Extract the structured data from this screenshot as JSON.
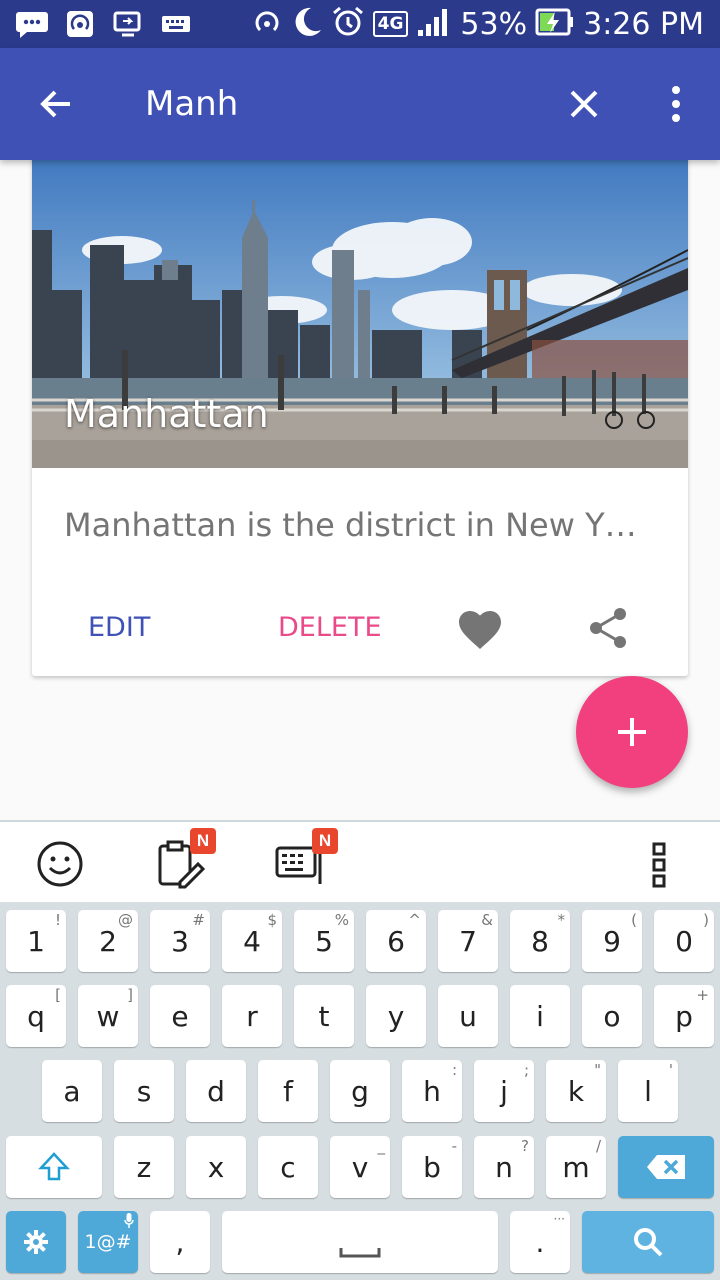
{
  "status_bar": {
    "network": "4G",
    "battery": "53%",
    "time": "3:26 PM"
  },
  "app_bar": {
    "search_value": "Manh"
  },
  "card": {
    "title": "Manhattan",
    "description": "Manhattan is the district in New Y…",
    "edit_label": "EDIT",
    "delete_label": "DELETE"
  },
  "colors": {
    "primary": "#3f51b5",
    "status_bar": "#2c3a8c",
    "accent": "#f2407f",
    "delete_text": "#e84a8a"
  },
  "keyboard": {
    "toolbar_badge": "N",
    "row1": [
      {
        "k": "1",
        "s": "!"
      },
      {
        "k": "2",
        "s": "@"
      },
      {
        "k": "3",
        "s": "#"
      },
      {
        "k": "4",
        "s": "$"
      },
      {
        "k": "5",
        "s": "%"
      },
      {
        "k": "6",
        "s": "^"
      },
      {
        "k": "7",
        "s": "&"
      },
      {
        "k": "8",
        "s": "*"
      },
      {
        "k": "9",
        "s": "("
      },
      {
        "k": "0",
        "s": ")"
      }
    ],
    "row2": [
      {
        "k": "q",
        "s": "["
      },
      {
        "k": "w",
        "s": "]"
      },
      {
        "k": "e",
        "s": ""
      },
      {
        "k": "r",
        "s": ""
      },
      {
        "k": "t",
        "s": ""
      },
      {
        "k": "y",
        "s": ""
      },
      {
        "k": "u",
        "s": ""
      },
      {
        "k": "i",
        "s": ""
      },
      {
        "k": "o",
        "s": ""
      },
      {
        "k": "p",
        "s": "+"
      }
    ],
    "row3": [
      {
        "k": "a",
        "s": ""
      },
      {
        "k": "s",
        "s": ""
      },
      {
        "k": "d",
        "s": ""
      },
      {
        "k": "f",
        "s": ""
      },
      {
        "k": "g",
        "s": ""
      },
      {
        "k": "h",
        "s": ":"
      },
      {
        "k": "j",
        "s": ";"
      },
      {
        "k": "k",
        "s": "\""
      },
      {
        "k": "l",
        "s": "'"
      }
    ],
    "row4": [
      {
        "k": "z",
        "s": ""
      },
      {
        "k": "x",
        "s": ""
      },
      {
        "k": "c",
        "s": ""
      },
      {
        "k": "v",
        "s": "_"
      },
      {
        "k": "b",
        "s": "-"
      },
      {
        "k": "n",
        "s": "?"
      },
      {
        "k": "m",
        "s": "/"
      }
    ],
    "symbols_label": "1@#",
    "comma": ",",
    "period": ".",
    "period_sup": "···"
  }
}
